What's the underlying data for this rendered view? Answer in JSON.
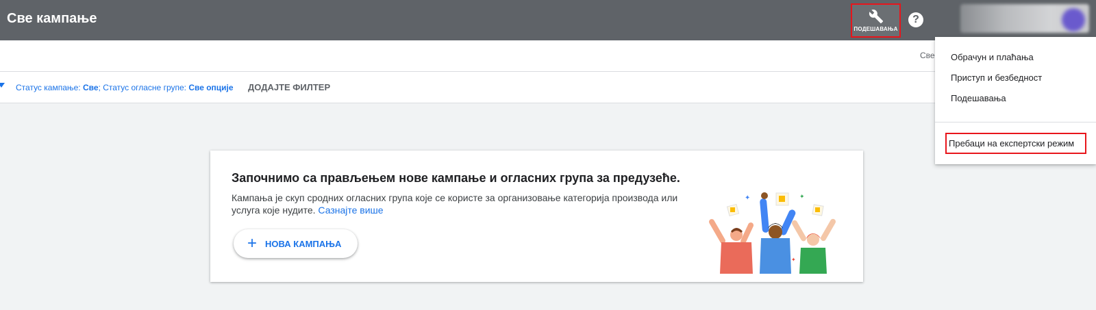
{
  "header": {
    "title": "Све кампање",
    "tools_label": "ПОДЕШАВАЊА",
    "help_icon": "?"
  },
  "subbar": {
    "right_text": "Све"
  },
  "filters": {
    "status_campaign_label": "Статус кампање: ",
    "status_campaign_value": "Све",
    "separator": "; ",
    "status_group_label": "Статус огласне групе: ",
    "status_group_value": "Све опције",
    "add_filter": "ДОДАЈТЕ ФИЛТЕР"
  },
  "card": {
    "title": "Започнимо са прављењем нове кампање и огласних група за предузеће.",
    "description": "Кампања је скуп сродних огласних група које се користе за организовање категорија производа или услуга које нудите. ",
    "learn_more": "Сазнајте више",
    "new_campaign_label": "НОВА КАМПАЊА",
    "plus_icon": "+"
  },
  "dropdown_menu": {
    "items": [
      "Обрачун и плаћања",
      "Приступ и безбедност",
      "Подешавања"
    ],
    "expert_mode": "Пребаци на експертски режим"
  },
  "colors": {
    "header_bg": "#5f6368",
    "accent_blue": "#1a73e8",
    "highlight_red": "#e8151b"
  },
  "icons": [
    "wrench-icon",
    "help-icon",
    "avatar",
    "plus-icon",
    "filter-arrow-icon"
  ]
}
